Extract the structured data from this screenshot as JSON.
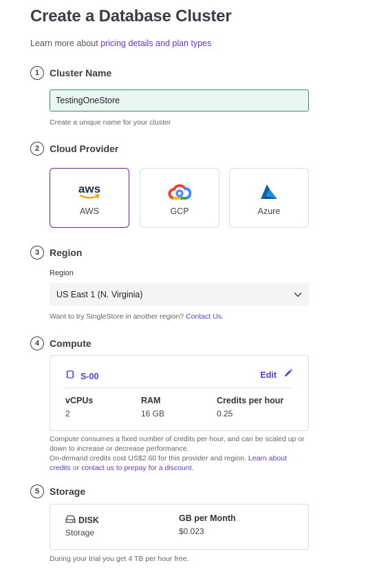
{
  "header": {
    "title": "Create a Database Cluster",
    "subtitle_prefix": "Learn more about ",
    "subtitle_link": "pricing details and plan types"
  },
  "steps": [
    {
      "number": "1",
      "title": "Cluster Name"
    },
    {
      "number": "2",
      "title": "Cloud Provider"
    },
    {
      "number": "3",
      "title": "Region"
    },
    {
      "number": "4",
      "title": "Compute"
    },
    {
      "number": "5",
      "title": "Storage"
    }
  ],
  "cluster_name": {
    "value": "TestingOneStore",
    "helper": "Create a unique name for your cluster"
  },
  "providers": [
    {
      "label": "AWS",
      "logo_text": "aws",
      "selected": true
    },
    {
      "label": "GCP",
      "selected": false
    },
    {
      "label": "Azure",
      "selected": false
    }
  ],
  "region": {
    "label": "Region",
    "value": "US East 1 (N. Virginia)",
    "helper_prefix": "Want to try SingleStore in another region? ",
    "helper_link": "Contact Us."
  },
  "compute": {
    "size": "S-00",
    "edit_label": "Edit",
    "columns": [
      {
        "label": "vCPUs",
        "value": "2"
      },
      {
        "label": "RAM",
        "value": "16 GB"
      },
      {
        "label": "Credits per hour",
        "value": "0.25"
      }
    ],
    "note_line1": "Compute consumes a fixed number of credits per hour, and can be scaled up or",
    "note_line2": "down to increase or decrease performance.",
    "note_line3_prefix": "On-demand credits cost US$2.60 for this provider and region. ",
    "note_link1": "Learn about",
    "note_link1b": "credits",
    "note_or": " or ",
    "note_link2": "contact us to prepay for a discount."
  },
  "storage": {
    "type_label": "DISK",
    "type_sub": "Storage",
    "price_label": "GB per Month",
    "price_value": "$0.023",
    "helper": "During your trial you get 4 TB per hour free."
  },
  "colors": {
    "accent": "#5b3bd1",
    "selected_border": "#6b2a88",
    "input_bg": "#e9f6f4",
    "input_border": "#3f8a68"
  }
}
